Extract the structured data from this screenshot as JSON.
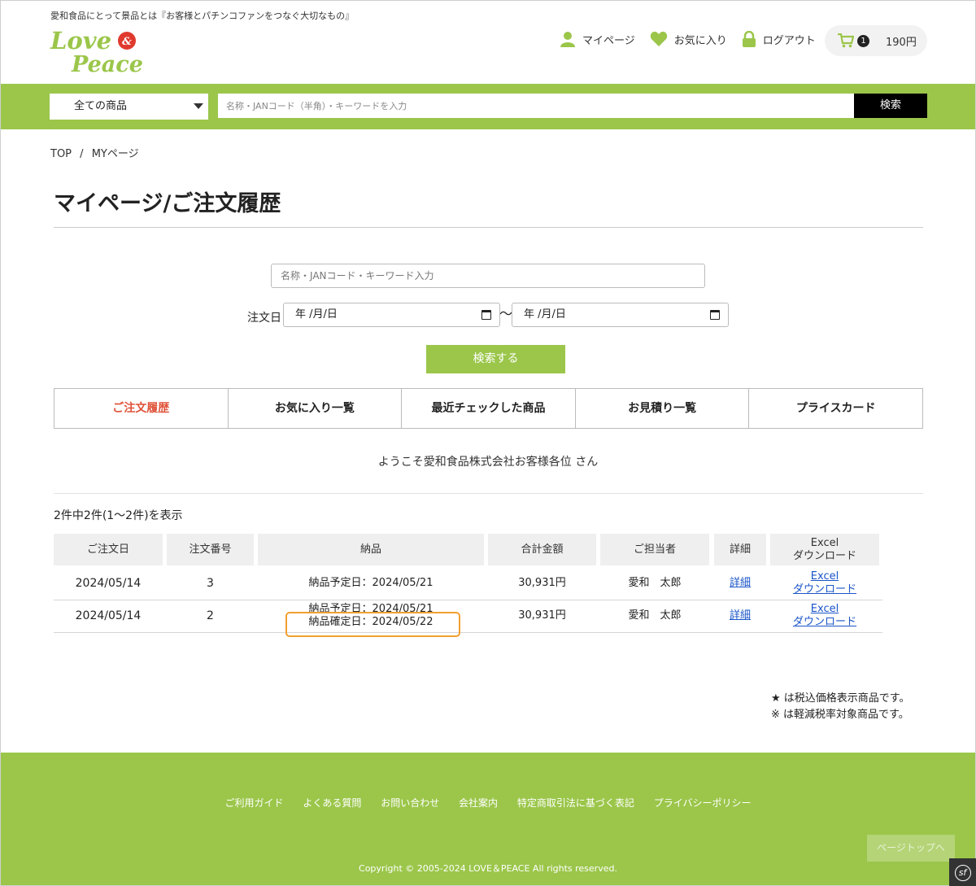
{
  "header": {
    "tagline": "愛和食品にとって景品とは『お客様とパチンコファンをつなぐ大切なもの』",
    "logo_text_top": "Love",
    "logo_text_amp": "&",
    "logo_text_bottom": "Peace",
    "nav": {
      "mypage": "マイページ",
      "favorites": "お気に入り",
      "logout": "ログアウト"
    },
    "cart": {
      "count": "1",
      "price": "190円"
    }
  },
  "search": {
    "category": "全ての商品",
    "placeholder": "名称・JANコード（半角）・キーワードを入力",
    "button": "検索"
  },
  "breadcrumb": {
    "top": "TOP",
    "separator": "/",
    "current": "MYページ"
  },
  "page_title": "マイページ/ご注文履歴",
  "filter": {
    "keyword_placeholder": "名称・JANコード・キーワード入力",
    "date_label": "注文日",
    "date_from": "年 /月/日",
    "date_to": "年 /月/日",
    "tilde": "〜",
    "submit": "検索する"
  },
  "tabs": [
    "ご注文履歴",
    "お気に入り一覧",
    "最近チェックした商品",
    "お見積り一覧",
    "プライスカード"
  ],
  "welcome": "ようこそ愛和食品株式会社お客様各位 さん",
  "result_count": "2件中2件(1～2件)を表示",
  "table": {
    "headers": {
      "date": "ご注文日",
      "number": "注文番号",
      "delivery": "納品",
      "total": "合計金額",
      "staff": "ご担当者",
      "detail": "詳細",
      "excel1": "Excel",
      "excel2": "ダウンロード"
    },
    "rows": [
      {
        "date": "2024/05/14",
        "number": "3",
        "delivery1": "納品予定日：2024/05/21",
        "delivery2": "",
        "total": "30,931円",
        "staff": "愛和　太郎",
        "detail": "詳細",
        "excel1": "Excel",
        "excel2": "ダウンロード"
      },
      {
        "date": "2024/05/14",
        "number": "2",
        "delivery1": "納品予定日：2024/05/21",
        "delivery2": "納品確定日：2024/05/22",
        "total": "30,931円",
        "staff": "愛和　太郎",
        "detail": "詳細",
        "excel1": "Excel",
        "excel2": "ダウンロード"
      }
    ]
  },
  "notes": {
    "line1": "★ は税込価格表示商品です。",
    "line2": "※ は軽減税率対象商品です。"
  },
  "footer": {
    "links": [
      "ご利用ガイド",
      "よくある質問",
      "お問い合わせ",
      "会社案内",
      "特定商取引法に基づく表記",
      "プライバシーポリシー"
    ],
    "copyright": "Copyright © 2005-2024 LOVE＆PEACE All rights reserved.",
    "page_top": "ページトップへ",
    "badge": "sf"
  },
  "colors": {
    "brand_green": "#9bc64a",
    "active_tab": "#e0533a",
    "link": "#1a55c8",
    "highlight_border": "#f0a030"
  }
}
